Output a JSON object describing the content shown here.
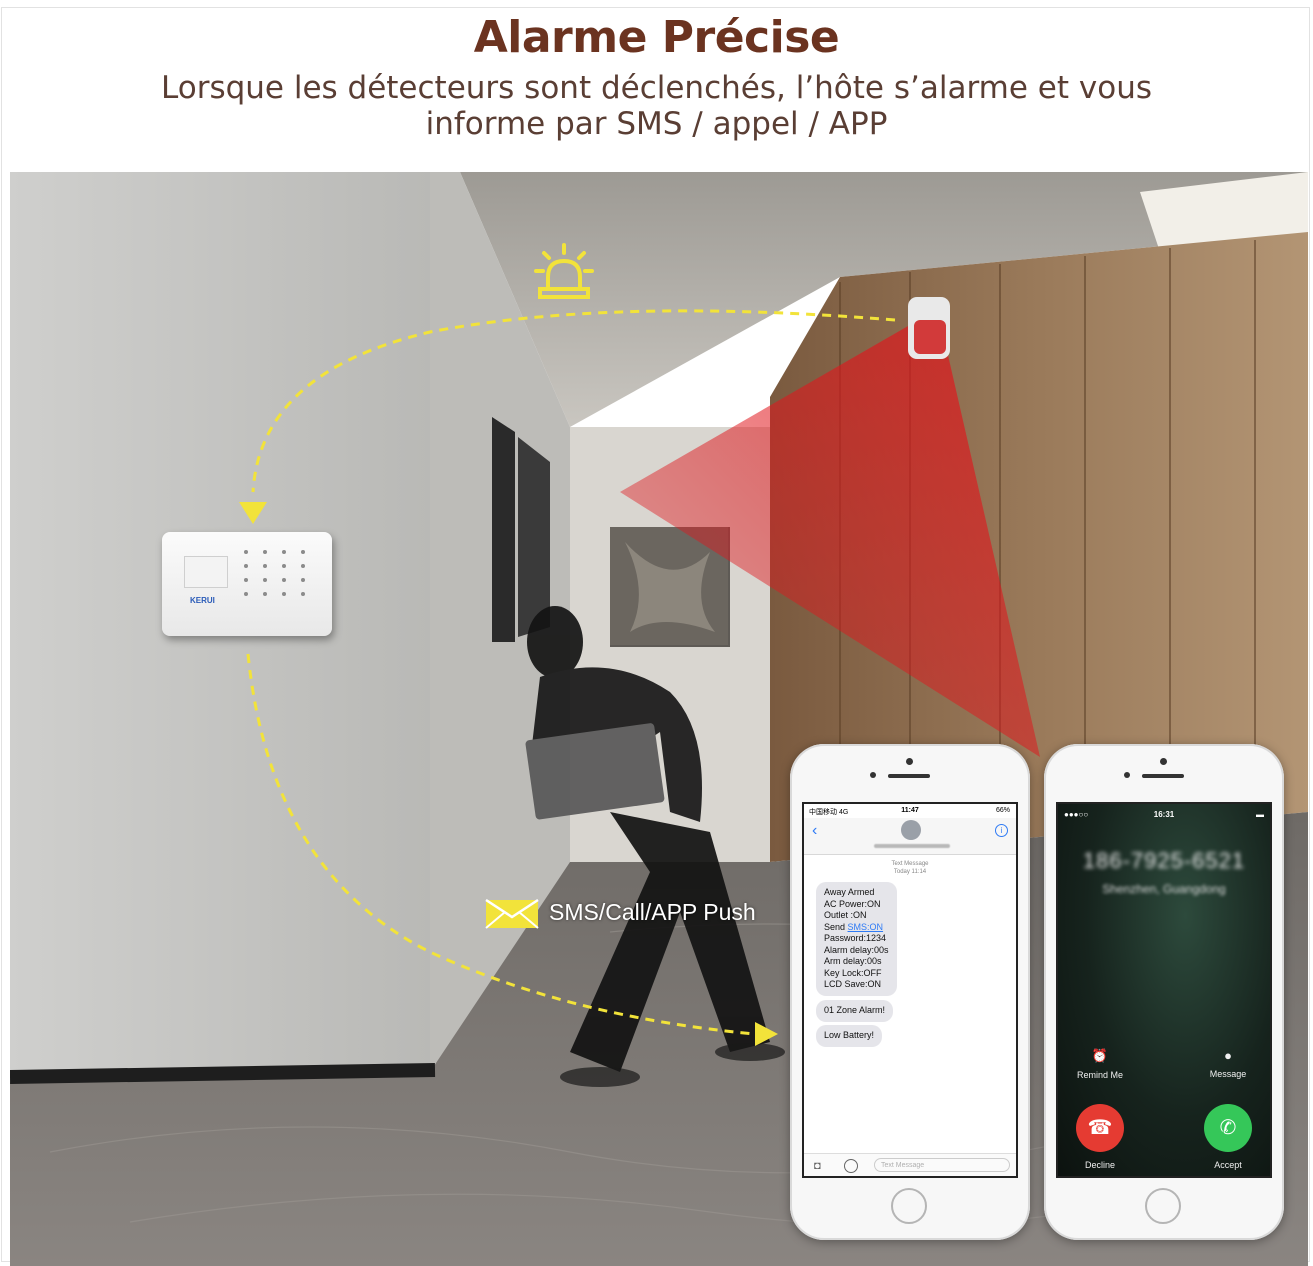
{
  "header": {
    "title": "Alarme Précise",
    "subtitle_line1": "Lorsque les détecteurs sont déclenchés, l’hôte s’alarme et vous",
    "subtitle_line2": "informe par SMS / appel / APP"
  },
  "scene": {
    "push_label": "SMS/Call/APP Push",
    "panel_brand": "KERUI",
    "flow_color": "#f2e33a",
    "beam_color": "#e0161c",
    "icons": [
      "siren-icon",
      "envelope-icon"
    ]
  },
  "sms_phone": {
    "status_left": "中国移动 4G",
    "status_time": "11:47",
    "status_right": "66%",
    "meta_line1": "Text Message",
    "meta_line2": "Today 11:14",
    "message_lines": [
      "Away Armed",
      "AC Power:ON",
      "Outlet   :ON",
      "Send SMS:ON",
      "Password:1234",
      "Alarm delay:00s",
      "Arm delay:00s",
      "Key Lock:OFF",
      "LCD Save:ON"
    ],
    "message_2": "01 Zone Alarm!",
    "message_3": "Low Battery!",
    "input_placeholder": "Text Message"
  },
  "call_phone": {
    "status_time": "16:31",
    "caller_number": "186-7925-6521",
    "caller_location": "Shenzhen, Guangdong",
    "remind_label": "Remind Me",
    "message_label": "Message",
    "decline_label": "Decline",
    "accept_label": "Accept"
  }
}
